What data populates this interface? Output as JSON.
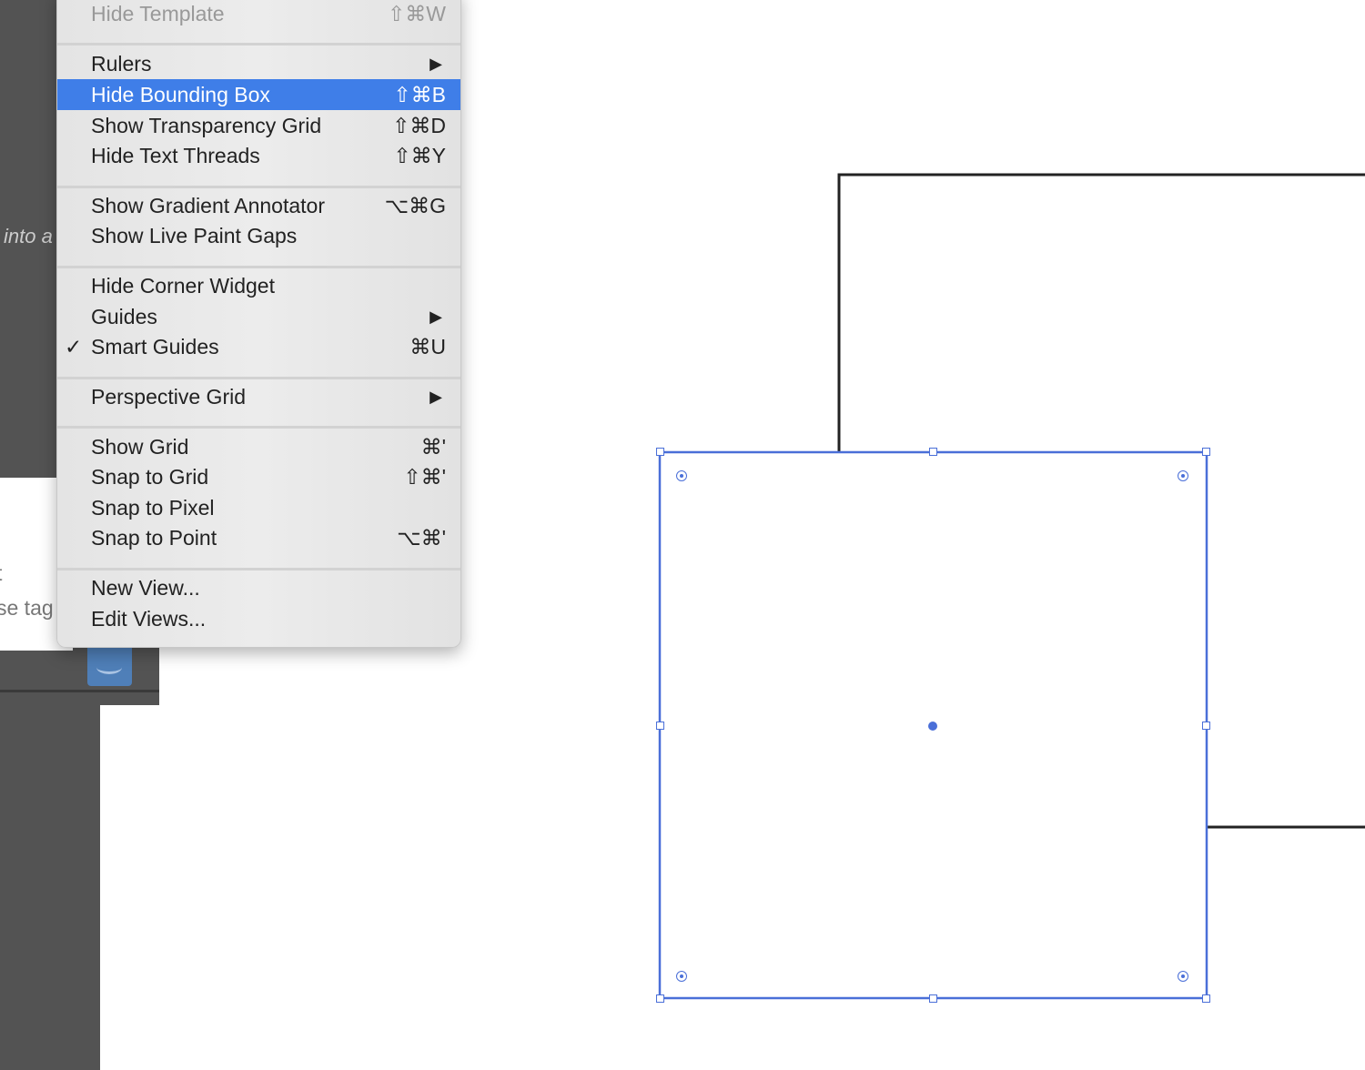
{
  "background": {
    "intro_text": "into a",
    "popup_lines": [
      "t",
      "se tag"
    ]
  },
  "menu": {
    "items": [
      {
        "label": "Hide Template",
        "shortcut": "⇧⌘W",
        "state": "disabled"
      },
      {
        "label": "Rulers",
        "shortcut": "▶",
        "state": "submenu"
      },
      {
        "label": "Hide Bounding Box",
        "shortcut": "⇧⌘B",
        "state": "highlighted"
      },
      {
        "label": "Show Transparency Grid",
        "shortcut": "⇧⌘D"
      },
      {
        "label": "Hide Text Threads",
        "shortcut": "⇧⌘Y"
      },
      {
        "label": "Show Gradient Annotator",
        "shortcut": "⌥⌘G"
      },
      {
        "label": "Show Live Paint Gaps",
        "shortcut": ""
      },
      {
        "label": "Hide Corner Widget",
        "shortcut": ""
      },
      {
        "label": "Guides",
        "shortcut": "▶",
        "state": "submenu"
      },
      {
        "label": "Smart Guides",
        "shortcut": "⌘U",
        "check": "✓"
      },
      {
        "label": "Perspective Grid",
        "shortcut": "▶",
        "state": "submenu"
      },
      {
        "label": "Show Grid",
        "shortcut": "⌘'"
      },
      {
        "label": "Snap to Grid",
        "shortcut": "⇧⌘'"
      },
      {
        "label": "Snap to Pixel",
        "shortcut": ""
      },
      {
        "label": "Snap to Point",
        "shortcut": "⌥⌘'"
      },
      {
        "label": "New View...",
        "shortcut": ""
      },
      {
        "label": "Edit Views...",
        "shortcut": ""
      }
    ]
  },
  "colors": {
    "selection": "#4a6fd8",
    "highlight": "#3f7ee8"
  }
}
